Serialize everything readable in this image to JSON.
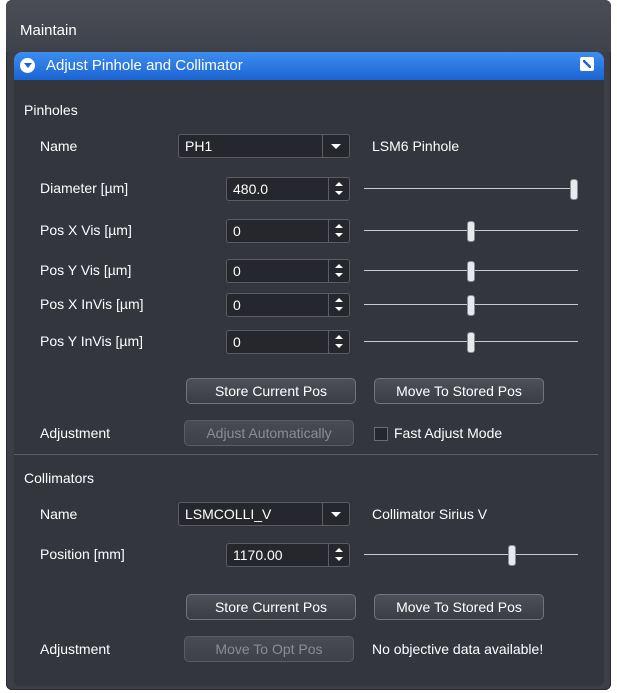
{
  "panel": {
    "title": "Maintain"
  },
  "header": {
    "title": "Adjust Pinhole and Collimator"
  },
  "pinholes": {
    "section": "Pinholes",
    "name_label": "Name",
    "name_value": "PH1",
    "device_label": "LSM6 Pinhole",
    "rows": [
      {
        "label": "Diameter [µm]",
        "value": "480.0",
        "slider_fraction": 1.0
      },
      {
        "label": "Pos X Vis [µm]",
        "value": "0",
        "slider_fraction": 0.5
      },
      {
        "label": "Pos Y Vis [µm]",
        "value": "0",
        "slider_fraction": 0.5
      },
      {
        "label": "Pos X InVis [µm]",
        "value": "0",
        "slider_fraction": 0.5
      },
      {
        "label": "Pos Y InVis [µm]",
        "value": "0",
        "slider_fraction": 0.5
      }
    ],
    "store_button": "Store Current Pos",
    "move_button": "Move To Stored Pos",
    "adjustment_label": "Adjustment",
    "adjust_button": "Adjust Automatically",
    "fast_adjust_label": "Fast Adjust Mode",
    "fast_adjust_checked": false
  },
  "collimators": {
    "section": "Collimators",
    "name_label": "Name",
    "name_value": "LSMCOLLI_V",
    "device_label": "Collimator Sirius V",
    "position_label": "Position [mm]",
    "position_value": "1170.00",
    "position_fraction": 0.7,
    "store_button": "Store Current Pos",
    "move_button": "Move To Stored Pos",
    "adjustment_label": "Adjustment",
    "opt_button": "Move To Opt Pos",
    "status_text": "No objective data available!"
  }
}
